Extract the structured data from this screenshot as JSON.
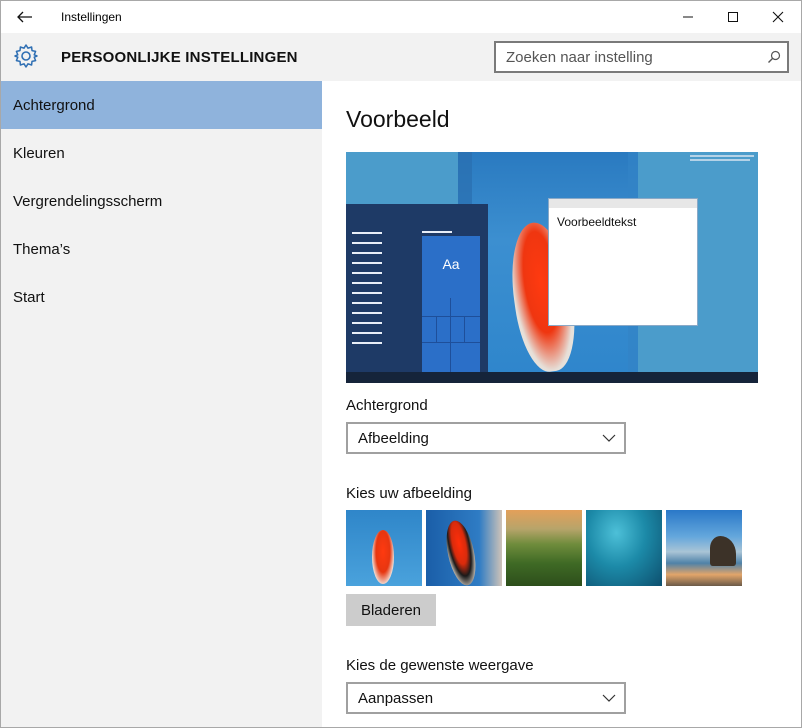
{
  "window": {
    "title": "Instellingen",
    "back_icon": "arrow-left-icon",
    "controls": [
      "minimize-icon",
      "maximize-icon",
      "close-icon"
    ]
  },
  "header": {
    "icon": "gear-icon",
    "title": "PERSOONLIJKE INSTELLINGEN",
    "search_placeholder": "Zoeken naar instelling",
    "search_value": "",
    "search_icon": "search-icon"
  },
  "sidebar": {
    "active_color": "#8fb3dc",
    "items": [
      {
        "label": "Achtergrond",
        "active": true
      },
      {
        "label": "Kleuren",
        "active": false
      },
      {
        "label": "Vergrendelingsscherm",
        "active": false
      },
      {
        "label": "Thema’s",
        "active": false
      },
      {
        "label": "Start",
        "active": false
      }
    ]
  },
  "main": {
    "preview_title": "Voorbeeld",
    "preview": {
      "tile_text": "Aa",
      "window_text": "Voorbeeldtekst"
    },
    "background": {
      "label": "Achtergrond",
      "value": "Afbeelding"
    },
    "pictures": {
      "label": "Kies uw afbeelding",
      "browse_label": "Bladeren"
    },
    "fit": {
      "label": "Kies de gewenste weergave",
      "value": "Aanpassen"
    }
  }
}
